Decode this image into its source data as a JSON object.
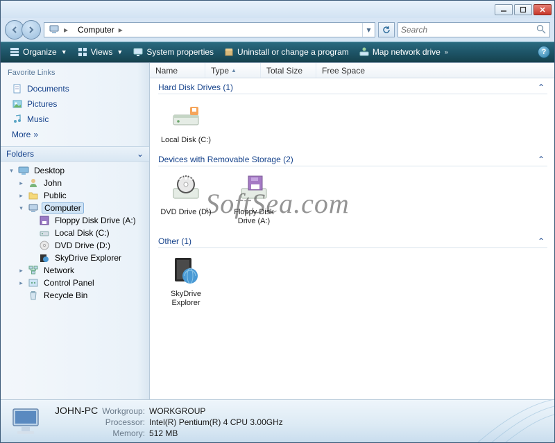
{
  "address": {
    "root_label": "Computer"
  },
  "search": {
    "placeholder": "Search"
  },
  "toolbar": {
    "organize": "Organize",
    "views": "Views",
    "system_properties": "System properties",
    "uninstall": "Uninstall or change a program",
    "map_drive": "Map network drive"
  },
  "sidebar": {
    "fav_header": "Favorite Links",
    "documents": "Documents",
    "pictures": "Pictures",
    "music": "Music",
    "more": "More",
    "folders_header": "Folders",
    "tree": {
      "desktop": "Desktop",
      "john": "John",
      "public": "Public",
      "computer": "Computer",
      "floppy": "Floppy Disk Drive (A:)",
      "local": "Local Disk (C:)",
      "dvd": "DVD Drive (D:)",
      "skydrive": "SkyDrive Explorer",
      "network": "Network",
      "control_panel": "Control Panel",
      "recycle_bin": "Recycle Bin"
    }
  },
  "columns": {
    "name": "Name",
    "type": "Type",
    "total_size": "Total Size",
    "free_space": "Free Space"
  },
  "groups": {
    "hard_disks": {
      "title": "Hard Disk Drives (1)",
      "items": [
        {
          "label": "Local Disk (C:)"
        }
      ]
    },
    "removable": {
      "title": "Devices with Removable Storage (2)",
      "items": [
        {
          "label": "DVD Drive (D:)"
        },
        {
          "label": "Floppy Disk Drive (A:)"
        }
      ]
    },
    "other": {
      "title": "Other (1)",
      "items": [
        {
          "label": "SkyDrive Explorer"
        }
      ]
    }
  },
  "details": {
    "computer_name": "JOHN-PC",
    "workgroup_label": "Workgroup:",
    "workgroup": "WORKGROUP",
    "processor_label": "Processor:",
    "processor": "Intel(R) Pentium(R) 4 CPU 3.00GHz",
    "memory_label": "Memory:",
    "memory": "512 MB"
  },
  "watermark": "SoftSea.com"
}
